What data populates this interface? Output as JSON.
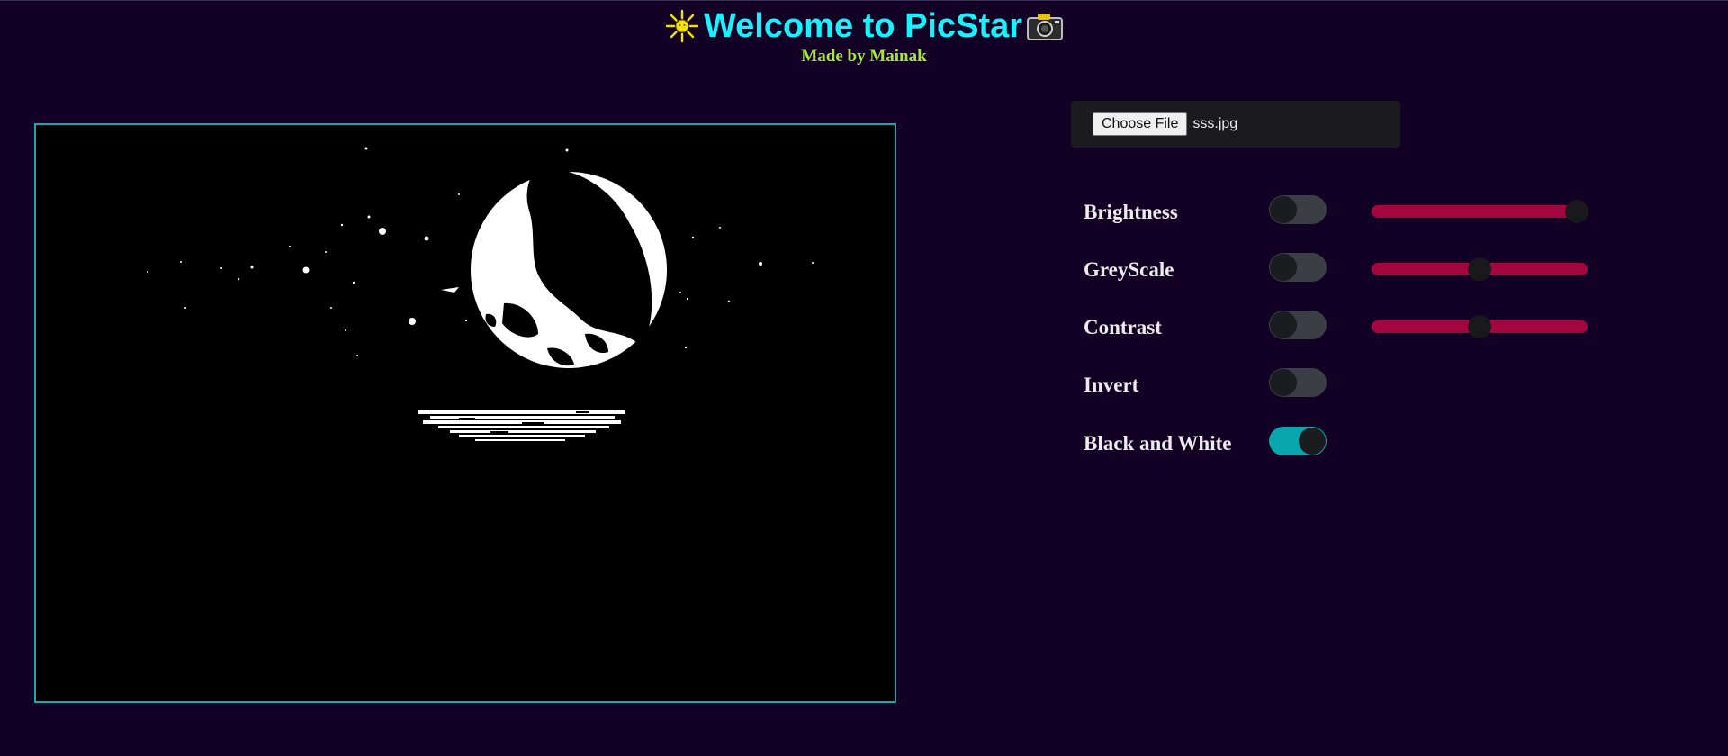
{
  "header": {
    "title": "Welcome to PicStar",
    "subtitle": "Made by Mainak",
    "left_icon": "sun-icon",
    "right_icon": "camera-icon"
  },
  "file_input": {
    "button_label": "Choose File",
    "file_name": "sss.jpg"
  },
  "controls": [
    {
      "label": "Brightness",
      "toggle_on": false,
      "slider_value": 0.95
    },
    {
      "label": "GreyScale",
      "toggle_on": false,
      "slider_value": 0.5
    },
    {
      "label": "Contrast",
      "toggle_on": false,
      "slider_value": 0.5
    },
    {
      "label": "Invert",
      "toggle_on": false
    },
    {
      "label": "Black and White",
      "toggle_on": true
    }
  ],
  "colors": {
    "background": "#130025",
    "title": "#18f2ff",
    "subtitle": "#a8e835",
    "toggle_on": "#0aa6ad",
    "slider_track": "#a3063f",
    "canvas_border": "#1aa7b0"
  }
}
